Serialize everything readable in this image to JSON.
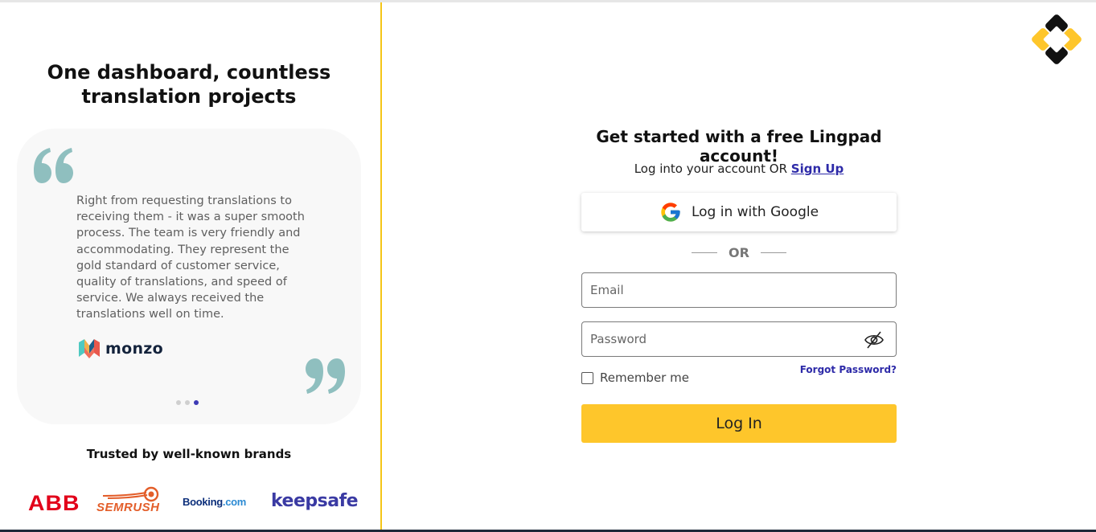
{
  "left": {
    "title": "One dashboard, countless translation projects",
    "testimonial": {
      "quote": "Right from requesting translations to receiving them - it was a super smooth process. The team is very friendly and accommodating. They represent the gold standard of customer service, quality of translations, and speed of service. We always received the translations well on time.",
      "company": "monzo",
      "slides_total": 3,
      "active_slide": 3
    },
    "trusted_heading": "Trusted by well-known brands",
    "brands": {
      "abb": "ABB",
      "semrush": "SEMRUSH",
      "booking_main": "Booking",
      "booking_tld": ".com",
      "keepsafe": "keepsafe"
    }
  },
  "login": {
    "heading": "Get started with a free Lingpad account!",
    "sub_text": "Log into your account OR",
    "signup_link": "Sign Up",
    "google_label": "Log in with Google",
    "or_text": "OR",
    "email_placeholder": "Email",
    "password_placeholder": "Password",
    "remember_label": "Remember me",
    "forgot_label": "Forgot Password?",
    "login_label": "Log In"
  },
  "colors": {
    "accent_yellow": "#fec62b",
    "link_blue": "#2d2aa8",
    "divider_yellow": "#f5c518",
    "quote_teal": "#8fbfbf"
  }
}
